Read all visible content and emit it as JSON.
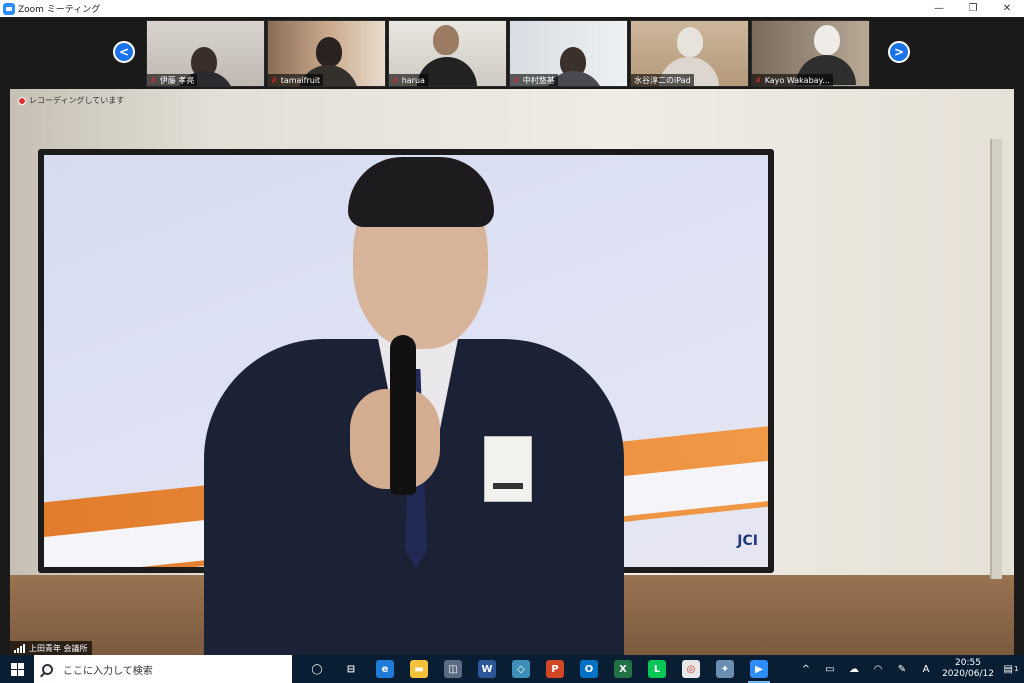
{
  "window": {
    "title": "Zoom ミーティング",
    "controls": [
      "—",
      "❐",
      "✕"
    ]
  },
  "gallery": {
    "prev_label": "<",
    "next_label": ">",
    "participants": [
      {
        "name": "伊藤 孝亮",
        "muted": true
      },
      {
        "name": "tamaifruit",
        "muted": true
      },
      {
        "name": "harua",
        "muted": true
      },
      {
        "name": "中村悠基",
        "muted": true
      },
      {
        "name": "水谷淳二のiPad",
        "muted": false
      },
      {
        "name": "Kayo Wakabay...",
        "muted": true
      }
    ]
  },
  "main_video": {
    "recording_text": "レコーディングしています",
    "slide_logo": "JCI",
    "venue_name": "上田青年 会議所"
  },
  "taskbar": {
    "search_placeholder": "ここに入力して検索",
    "apps": [
      {
        "icon": "task-view-icon",
        "color": "#0a1e33"
      },
      {
        "icon": "cortana-icon",
        "color": "#0a1e33"
      },
      {
        "icon": "edge-icon",
        "color": "#1e7bd7"
      },
      {
        "icon": "file-explorer-icon",
        "color": "#f3c13a"
      },
      {
        "icon": "store-icon",
        "color": "#5b6c80"
      },
      {
        "icon": "word-icon",
        "color": "#2b579a"
      },
      {
        "icon": "app-icon",
        "color": "#3d8fb8"
      },
      {
        "icon": "powerpoint-icon",
        "color": "#d24726"
      },
      {
        "icon": "outlook-icon",
        "color": "#0072c6"
      },
      {
        "icon": "excel-icon",
        "color": "#217346"
      },
      {
        "icon": "line-icon",
        "color": "#06c755"
      },
      {
        "icon": "chrome-icon",
        "color": "#e8e8e8"
      },
      {
        "icon": "paint-icon",
        "color": "#6a8fb3"
      },
      {
        "icon": "zoom-icon",
        "color": "#2d8cff"
      }
    ],
    "ime_label": "A",
    "time": "20:55",
    "date": "2020/06/12",
    "notification_count": "1"
  }
}
